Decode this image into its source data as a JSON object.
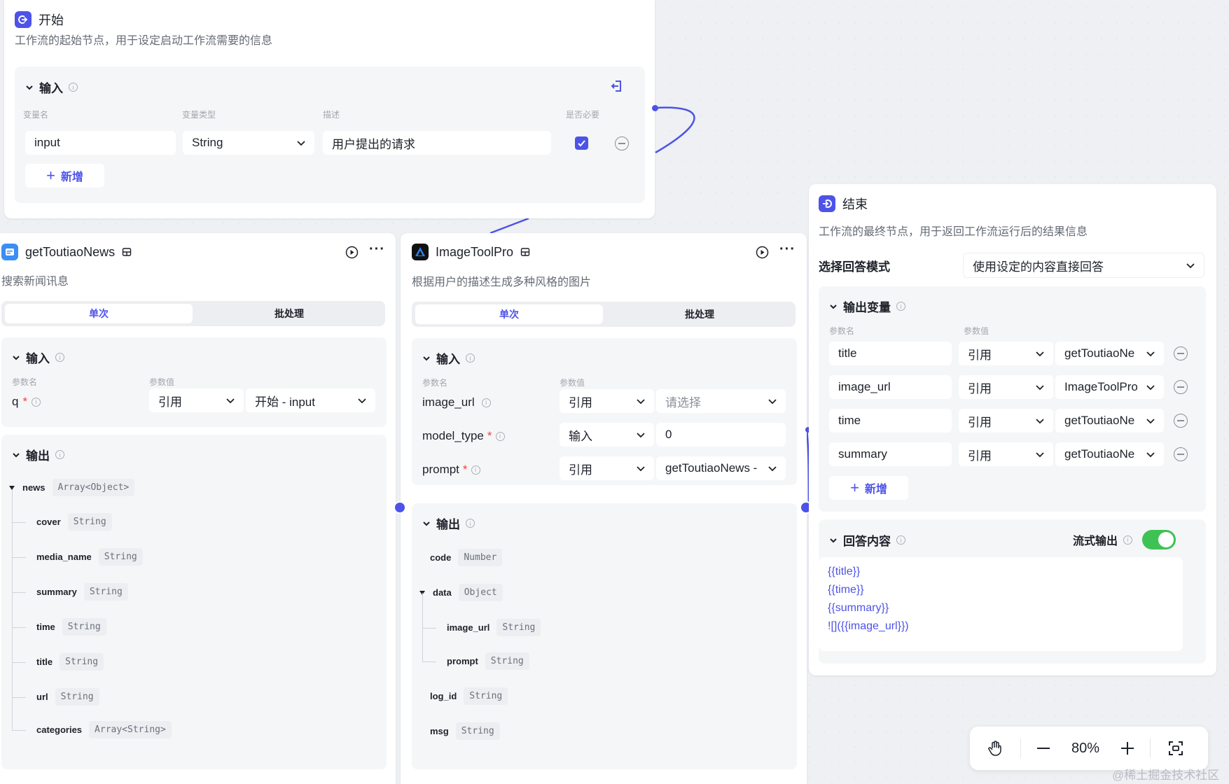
{
  "colors": {
    "accent": "#4d53e8",
    "toggle": "#3ec254",
    "required": "#f53f3f"
  },
  "start": {
    "title": "开始",
    "desc": "工作流的起始节点，用于设定启动工作流需要的信息",
    "input_title": "输入",
    "cols": {
      "name": "变量名",
      "type": "变量类型",
      "desc": "描述",
      "required": "是否必要"
    },
    "row": {
      "name": "input",
      "type": "String",
      "desc": "用户提出的请求"
    },
    "add_label": "新增"
  },
  "toutiao": {
    "title": "getToutiaoNews",
    "desc": "搜索新闻讯息",
    "tab_single": "单次",
    "tab_batch": "批处理",
    "input_title": "输入",
    "cols": {
      "name": "参数名",
      "value": "参数值"
    },
    "param": {
      "name": "q",
      "req": "*",
      "mode": "引用",
      "value": "开始 - input"
    },
    "output_title": "输出",
    "outputs": [
      {
        "name": "news",
        "type": "Array<Object>"
      },
      {
        "name": "cover",
        "type": "String"
      },
      {
        "name": "media_name",
        "type": "String"
      },
      {
        "name": "summary",
        "type": "String"
      },
      {
        "name": "time",
        "type": "String"
      },
      {
        "name": "title",
        "type": "String"
      },
      {
        "name": "url",
        "type": "String"
      },
      {
        "name": "categories",
        "type": "Array<String>"
      }
    ]
  },
  "image": {
    "title": "ImageToolPro",
    "desc": "根据用户的描述生成多种风格的图片",
    "tab_single": "单次",
    "tab_batch": "批处理",
    "input_title": "输入",
    "cols": {
      "name": "参数名",
      "value": "参数值"
    },
    "params": [
      {
        "name": "image_url",
        "req": "",
        "mode": "引用",
        "value": "请选择"
      },
      {
        "name": "model_type",
        "req": "*",
        "mode": "输入",
        "value": "0"
      },
      {
        "name": "prompt",
        "req": "*",
        "mode": "引用",
        "value": "getToutiaoNews -"
      }
    ],
    "output_title": "输出",
    "outputs": [
      {
        "name": "code",
        "type": "Number"
      },
      {
        "name": "data",
        "type": "Object"
      },
      {
        "name": "image_url",
        "type": "String"
      },
      {
        "name": "prompt",
        "type": "String"
      },
      {
        "name": "log_id",
        "type": "String"
      },
      {
        "name": "msg",
        "type": "String"
      }
    ]
  },
  "end": {
    "title": "结束",
    "desc": "工作流的最终节点，用于返回工作流运行后的结果信息",
    "mode_label": "选择回答模式",
    "mode_value": "使用设定的内容直接回答",
    "output_title": "输出变量",
    "cols": {
      "name": "参数名",
      "value": "参数值"
    },
    "rows": [
      {
        "name": "title",
        "mode": "引用",
        "value": "getToutiaoNe"
      },
      {
        "name": "image_url",
        "mode": "引用",
        "value": "ImageToolPro"
      },
      {
        "name": "time",
        "mode": "引用",
        "value": "getToutiaoNe"
      },
      {
        "name": "summary",
        "mode": "引用",
        "value": "getToutiaoNe"
      }
    ],
    "add_label": "新增",
    "answer_title": "回答内容",
    "stream_label": "流式输出",
    "stream_on": true,
    "answer_lines": [
      "{{title}}",
      "{{time}}",
      "{{summary}}",
      "![]({{image_url}})"
    ]
  },
  "toolbar": {
    "zoom": "80%"
  },
  "watermark": "@稀土掘金技术社区"
}
